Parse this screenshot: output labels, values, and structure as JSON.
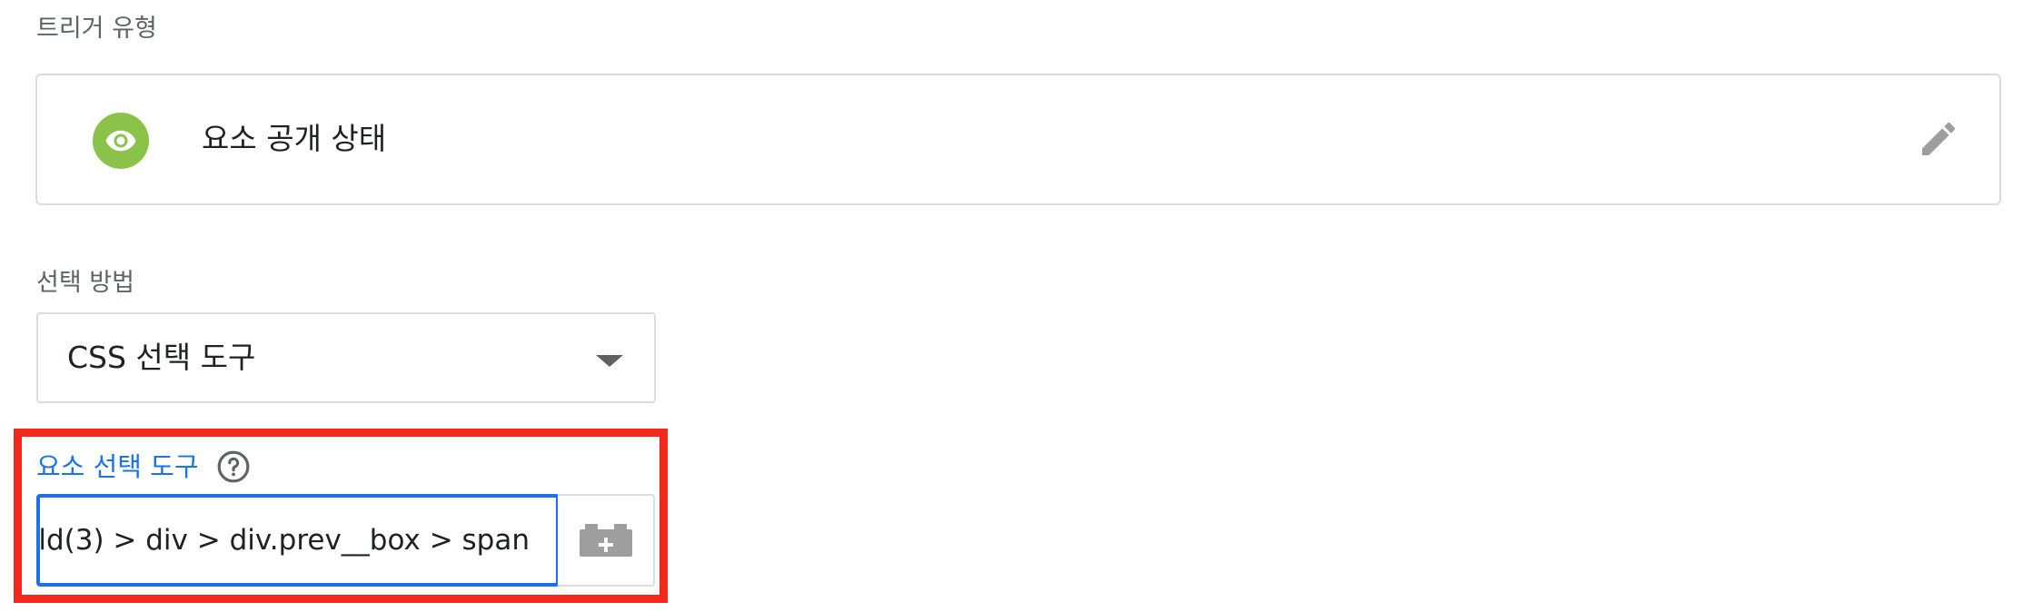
{
  "trigger_type": {
    "label": "트리거 유형",
    "name": "요소 공개 상태",
    "icon": "eye-icon",
    "icon_color": "#8bc34a"
  },
  "selection_method": {
    "label": "선택 방법",
    "value": "CSS 선택 도구"
  },
  "element_selector": {
    "label": "요소 선택 도구",
    "value": "ld(3) > div > div.prev__box > span",
    "accent": "#1a73e8"
  },
  "highlight_color": "#f4281a"
}
